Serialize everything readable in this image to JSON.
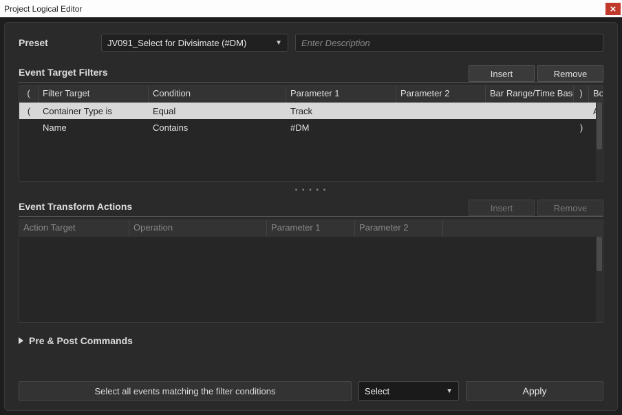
{
  "window": {
    "title": "Project Logical Editor"
  },
  "preset": {
    "label": "Preset",
    "value": "JV091_Select for Divisimate (#DM)",
    "description_placeholder": "Enter Description"
  },
  "filters": {
    "title": "Event Target Filters",
    "insert_label": "Insert",
    "remove_label": "Remove",
    "columns": [
      "(",
      "Filter Target",
      "Condition",
      "Parameter 1",
      "Parameter 2",
      "Bar Range/Time Base",
      ")",
      "Bool"
    ],
    "rows": [
      {
        "open": "(",
        "target": "Container Type is",
        "condition": "Equal",
        "p1": "Track",
        "p2": "",
        "bar": "",
        "close": "",
        "bool": "And",
        "selected": true
      },
      {
        "open": "",
        "target": "Name",
        "condition": "Contains",
        "p1": "#DM",
        "p2": "",
        "bar": "",
        "close": ")",
        "bool": "",
        "selected": false
      }
    ]
  },
  "actions": {
    "title": "Event Transform Actions",
    "insert_label": "Insert",
    "remove_label": "Remove",
    "columns": [
      "Action Target",
      "Operation",
      "Parameter 1",
      "Parameter 2",
      ""
    ]
  },
  "prepost": {
    "title": "Pre & Post Commands"
  },
  "bottom": {
    "description": "Select all events matching the filter conditions",
    "function": "Select",
    "apply_label": "Apply"
  }
}
